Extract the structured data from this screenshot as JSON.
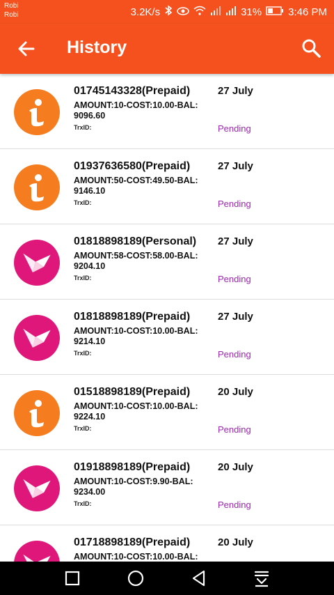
{
  "statusbar": {
    "carrier_line1": "Robi",
    "carrier_line2": "Robi",
    "speed": "3.2K/s",
    "battery": "31%",
    "time": "3:46 PM"
  },
  "header": {
    "title": "History",
    "back_icon": "arrow-left-icon",
    "search_icon": "search-icon"
  },
  "transactions": [
    {
      "number": "01745143328(Prepaid)",
      "details": "AMOUNT:10-COST:10.00-BAL: 9096.60",
      "trx": "TrxID:",
      "date": "27 July",
      "status": "Pending",
      "icon": "info"
    },
    {
      "number": "01937636580(Prepaid)",
      "details": "AMOUNT:50-COST:49.50-BAL: 9146.10",
      "trx": "TrxID:",
      "date": "27 July",
      "status": "Pending",
      "icon": "info"
    },
    {
      "number": "01818898189(Personal)",
      "details": "AMOUNT:58-COST:58.00-BAL: 9204.10",
      "trx": "TrxID:",
      "date": "27 July",
      "status": "Pending",
      "icon": "bird"
    },
    {
      "number": "01818898189(Prepaid)",
      "details": "AMOUNT:10-COST:10.00-BAL: 9214.10",
      "trx": "TrxID:",
      "date": "27 July",
      "status": "Pending",
      "icon": "bird"
    },
    {
      "number": "01518898189(Prepaid)",
      "details": "AMOUNT:10-COST:10.00-BAL: 9224.10",
      "trx": "TrxID:",
      "date": "20 July",
      "status": "Pending",
      "icon": "info"
    },
    {
      "number": "01918898189(Prepaid)",
      "details": "AMOUNT:10-COST:9.90-BAL: 9234.00",
      "trx": "TrxID:",
      "date": "20 July",
      "status": "Pending",
      "icon": "bird"
    },
    {
      "number": "01718898189(Prepaid)",
      "details": "AMOUNT:10-COST:10.00-BAL:",
      "trx": "",
      "date": "20 July",
      "status": "",
      "icon": "bird"
    }
  ],
  "colors": {
    "primary": "#f5511e",
    "info_icon": "#f57c1f",
    "bird_icon": "#e0177a",
    "pending": "#9c27b0"
  }
}
